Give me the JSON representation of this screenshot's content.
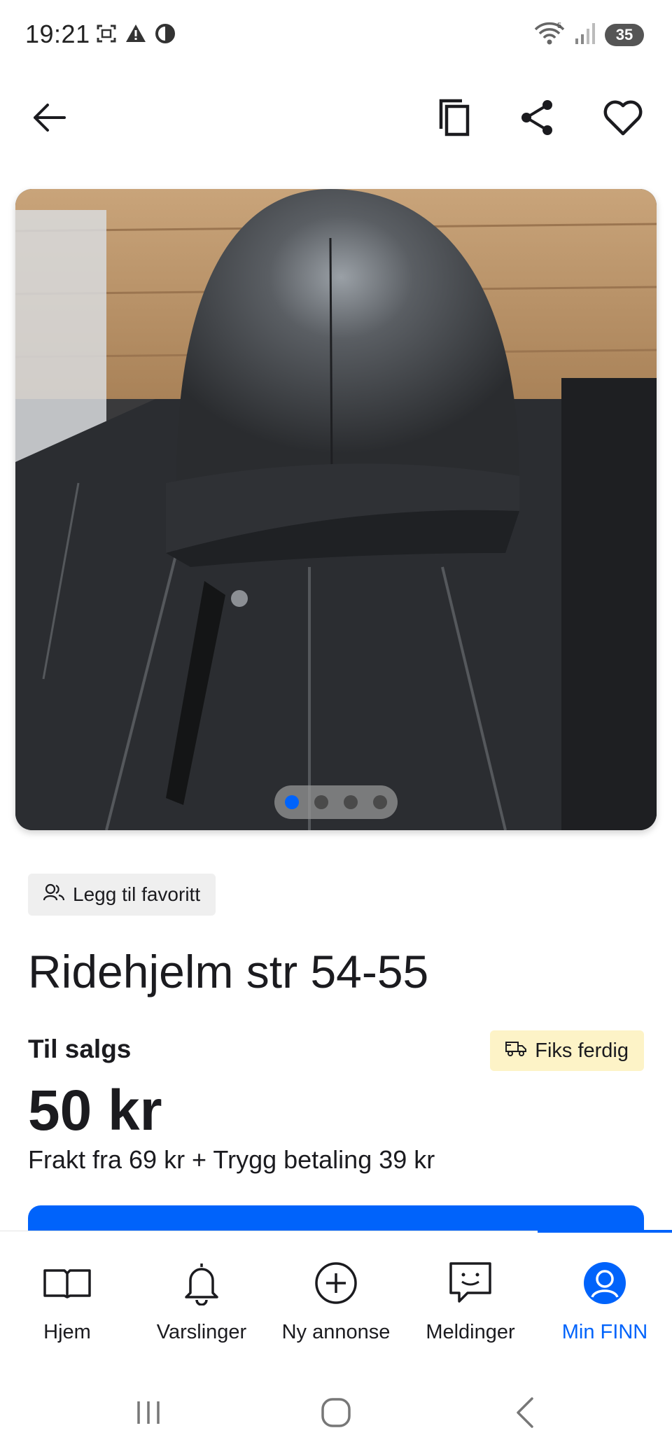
{
  "status_bar": {
    "time": "19:21",
    "battery": "35",
    "icons_left": [
      "screenshot-icon",
      "warning-icon",
      "vpn-icon"
    ],
    "icons_right": [
      "wifi-icon",
      "signal-icon",
      "battery-icon"
    ]
  },
  "top_bar": {
    "icons": [
      "back-arrow-icon",
      "copy-icon",
      "share-icon",
      "heart-icon"
    ]
  },
  "carousel": {
    "image_count": 4,
    "active_index": 0,
    "image_subject": "riding-helmet-photo"
  },
  "listing": {
    "favorite_chip": "Legg til favoritt",
    "title": "Ridehjelm str 54-55",
    "sale_label": "Til salgs",
    "badge": "Fiks ferdig",
    "price": "50 kr",
    "shipping": "Frakt fra 69 kr + Trygg betaling 39 kr"
  },
  "bottom_nav": {
    "items": [
      {
        "label": "Hjem",
        "icon": "book-icon"
      },
      {
        "label": "Varslinger",
        "icon": "bell-icon"
      },
      {
        "label": "Ny annonse",
        "icon": "plus-circle-icon"
      },
      {
        "label": "Meldinger",
        "icon": "chat-icon"
      },
      {
        "label": "Min FINN",
        "icon": "profile-icon"
      }
    ],
    "active": "Min FINN"
  },
  "colors": {
    "accent": "#0063fb",
    "badge_bg": "#fdf3c7",
    "chip_bg": "#efefef",
    "text": "#1b1b1f"
  }
}
